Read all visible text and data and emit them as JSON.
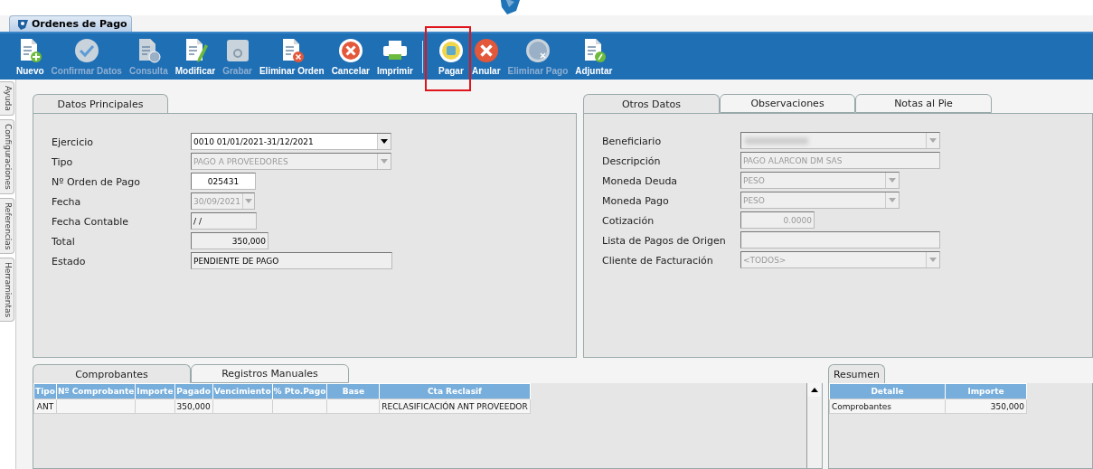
{
  "window_tab": {
    "title": "Ordenes de Pago",
    "selected": true
  },
  "toolbar": [
    {
      "label": "Nuevo",
      "disabled": false
    },
    {
      "label": "Confirmar Datos",
      "disabled": true
    },
    {
      "label": "Consulta",
      "disabled": true
    },
    {
      "label": "Modificar",
      "disabled": false
    },
    {
      "label": "Grabar",
      "disabled": true
    },
    {
      "label": "Eliminar Orden",
      "disabled": false
    },
    {
      "label": "Cancelar",
      "disabled": false
    },
    {
      "label": "Imprimir",
      "disabled": false
    },
    {
      "label": "Pagar",
      "disabled": false
    },
    {
      "label": "Anular",
      "disabled": false
    },
    {
      "label": "Eliminar Pago",
      "disabled": true
    },
    {
      "label": "Adjuntar",
      "disabled": false
    }
  ],
  "side_tabs": [
    "Ayuda",
    "Configuraciones",
    "Referencias",
    "Herramientas"
  ],
  "left_panel": {
    "tabs": [
      {
        "label": "Datos Principales",
        "selected": true
      }
    ],
    "fields": [
      {
        "label": "Ejercicio",
        "value": "0010 01/01/2021-31/12/2021",
        "kind": "select",
        "disabled": false,
        "readonly": false
      },
      {
        "label": "Tipo",
        "value": "PAGO A PROVEEDORES",
        "kind": "select",
        "disabled": true,
        "readonly": true
      },
      {
        "label": "Nº Orden de Pago",
        "value": "025431",
        "kind": "code",
        "disabled": false,
        "readonly": false
      },
      {
        "label": "Fecha",
        "value": "30/09/2021",
        "kind": "select",
        "disabled": true,
        "readonly": true
      },
      {
        "label": "Fecha Contable",
        "value": "/  /",
        "kind": "text",
        "disabled": false,
        "readonly": true
      },
      {
        "label": "Total",
        "value": "350,000",
        "kind": "number",
        "disabled": false,
        "readonly": true
      },
      {
        "label": "Estado",
        "value": "PENDIENTE DE PAGO",
        "kind": "text",
        "disabled": false,
        "readonly": true
      }
    ]
  },
  "right_panel": {
    "tabs": [
      {
        "label": "Otros Datos",
        "selected": true
      },
      {
        "label": "Observaciones",
        "selected": false
      },
      {
        "label": "Notas al Pie",
        "selected": false
      }
    ],
    "fields": [
      {
        "label": "Beneficiario",
        "kind": "blurred-select",
        "disabled": true,
        "readonly": true
      },
      {
        "label": "Descripción",
        "value": "PAGO ALARCON DM SAS",
        "kind": "text",
        "disabled": true,
        "readonly": true
      },
      {
        "label": "Moneda Deuda",
        "value": "PESO",
        "kind": "select",
        "disabled": true,
        "readonly": true
      },
      {
        "label": "Moneda Pago",
        "value": "PESO",
        "kind": "select",
        "disabled": true,
        "readonly": true
      },
      {
        "label": "Cotización",
        "value": "0.0000",
        "kind": "number",
        "disabled": true,
        "readonly": true
      },
      {
        "label": "Lista de Pagos de Origen",
        "kind": "text",
        "disabled": true,
        "readonly": true
      },
      {
        "label": "Cliente de Facturación",
        "value": "<TODOS>",
        "kind": "select",
        "disabled": true,
        "readonly": true
      }
    ]
  },
  "bottom_left": {
    "tabs": [
      {
        "label": "Comprobantes",
        "selected": true
      },
      {
        "label": "Registros Manuales",
        "selected": false
      }
    ],
    "table": {
      "columns": [
        "Tipo",
        "Nº Comprobante",
        "Importe",
        "Pagado",
        "Vencimiento",
        "% Pto.Pago",
        "Base",
        "Cta Reclasif"
      ],
      "rows": [
        [
          "ANT",
          "",
          "",
          "350,000",
          "",
          "",
          "",
          "RECLASIFICACIÓN ANT PROVEEDOR"
        ]
      ]
    }
  },
  "bottom_right": {
    "tabs": [
      {
        "label": "Resumen",
        "selected": true
      }
    ],
    "table": {
      "columns": [
        "Detalle",
        "Importe"
      ],
      "rows": [
        [
          "Comprobantes",
          "350,000"
        ]
      ]
    }
  }
}
